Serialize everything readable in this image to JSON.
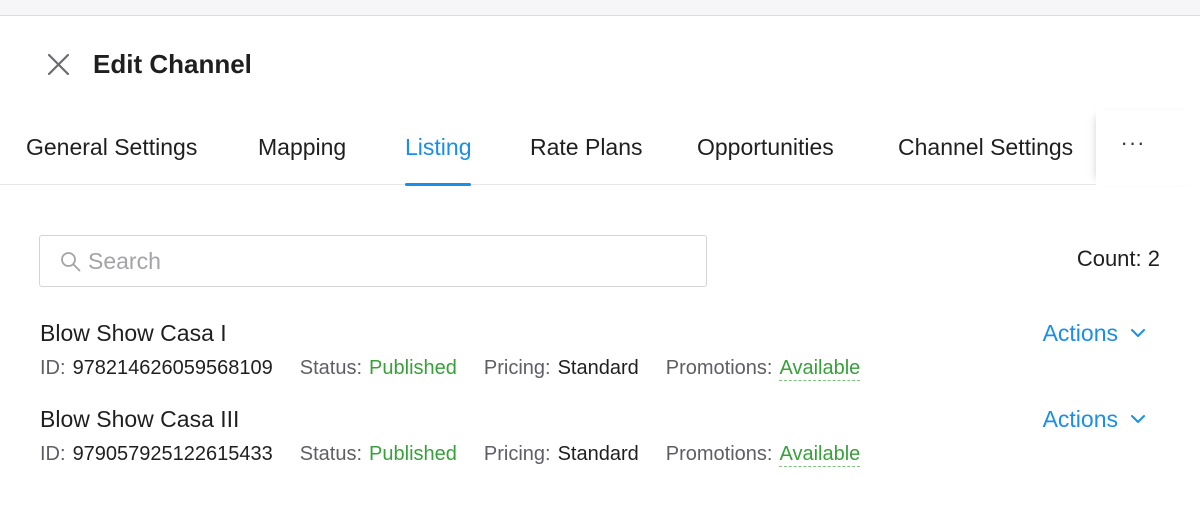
{
  "header": {
    "title": "Edit Channel"
  },
  "tabs": [
    {
      "label": "General Settings"
    },
    {
      "label": "Mapping"
    },
    {
      "label": "Listing",
      "active": true
    },
    {
      "label": "Rate Plans"
    },
    {
      "label": "Opportunities"
    },
    {
      "label": "Channel Settings"
    }
  ],
  "tabs_more_label": "···",
  "search": {
    "placeholder": "Search",
    "value": ""
  },
  "count_text": "Count: 2",
  "listings": [
    {
      "name": "Blow Show Casa I",
      "id_label": "ID:",
      "id": "978214626059568109",
      "status_label": "Status:",
      "status": "Published",
      "pricing_label": "Pricing:",
      "pricing": "Standard",
      "promotions_label": "Promotions:",
      "promotions": "Available",
      "actions_label": "Actions"
    },
    {
      "name": "Blow Show Casa III",
      "id_label": "ID:",
      "id": "979057925122615433",
      "status_label": "Status:",
      "status": "Published",
      "pricing_label": "Pricing:",
      "pricing": "Standard",
      "promotions_label": "Promotions:",
      "promotions": "Available",
      "actions_label": "Actions"
    }
  ],
  "colors": {
    "accent": "#1a8ee8",
    "published": "#38a03a",
    "available": "#38a03a"
  },
  "icons": {
    "close": "close-icon",
    "search": "search-icon",
    "chevron": "chevron-down-icon"
  }
}
